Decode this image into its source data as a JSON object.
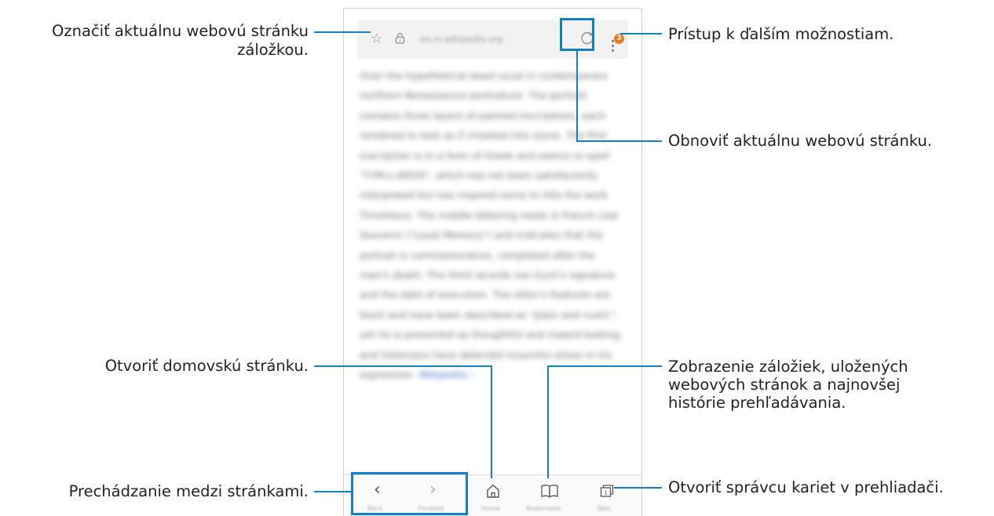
{
  "browser": {
    "url": "en.m.wikipedia.org",
    "badge_count": "3",
    "icons": {
      "bookmark": "star-icon",
      "lock": "lock-icon",
      "reload": "reload-icon",
      "menu": "more-options-icon"
    },
    "content_paragraph": "Over the hypothetical dead usual in contemporary northern Renaissance portraiture. The portrait contains three layers of painted inscriptions, each rendered to look as if chiseled into stone. The first inscription is in a form of Greek and seems to spell \"TYM.s.dIEOS\", which has not been satisfactorily interpreted but has inspired some to title the work Timotheus. The middle lettering reads in French Leal Souvenir (\"Loyal Memory\") and indicates that the portrait is commemorative, completed after the man's death. The third records van Eyck's signature and the date of execution. The sitter's features are blunt and have been described as \"plain and rustic\", yet he is presented as thoughtful and inward-looking, and historians have detected mournful stress in his expression.",
    "content_link": "Wikipedia ›",
    "bottom_bar": {
      "back_icon": "‹",
      "forward_icon": "›",
      "home_icon": "⌂",
      "bookmarks_icon": "📖",
      "tabs_icon": "⧉",
      "labels": {
        "back": "Back",
        "forward": "Forward",
        "home": "Home",
        "bookmarks": "Bookmarks",
        "tabs": "Tabs"
      }
    }
  },
  "callouts": {
    "bookmark_line1": "Označiť aktuálnu webovú stránku",
    "bookmark_line2": "záložkou.",
    "more_options": "Prístup k ďalším možnostiam.",
    "reload": "Obnoviť aktuálnu webovú stránku.",
    "home": "Otvoriť domovskú stránku.",
    "bookmarks_line1": "Zobrazenie záložiek, uložených",
    "bookmarks_line2": "webových stránok a najnovšej",
    "bookmarks_line3": "histórie prehľadávania.",
    "navigate": "Prechádzanie medzi stránkami.",
    "tabs": "Otvoriť správcu kariet v prehliadači."
  },
  "colors": {
    "callout": "#1180c8",
    "badge": "#ea7a1c"
  }
}
